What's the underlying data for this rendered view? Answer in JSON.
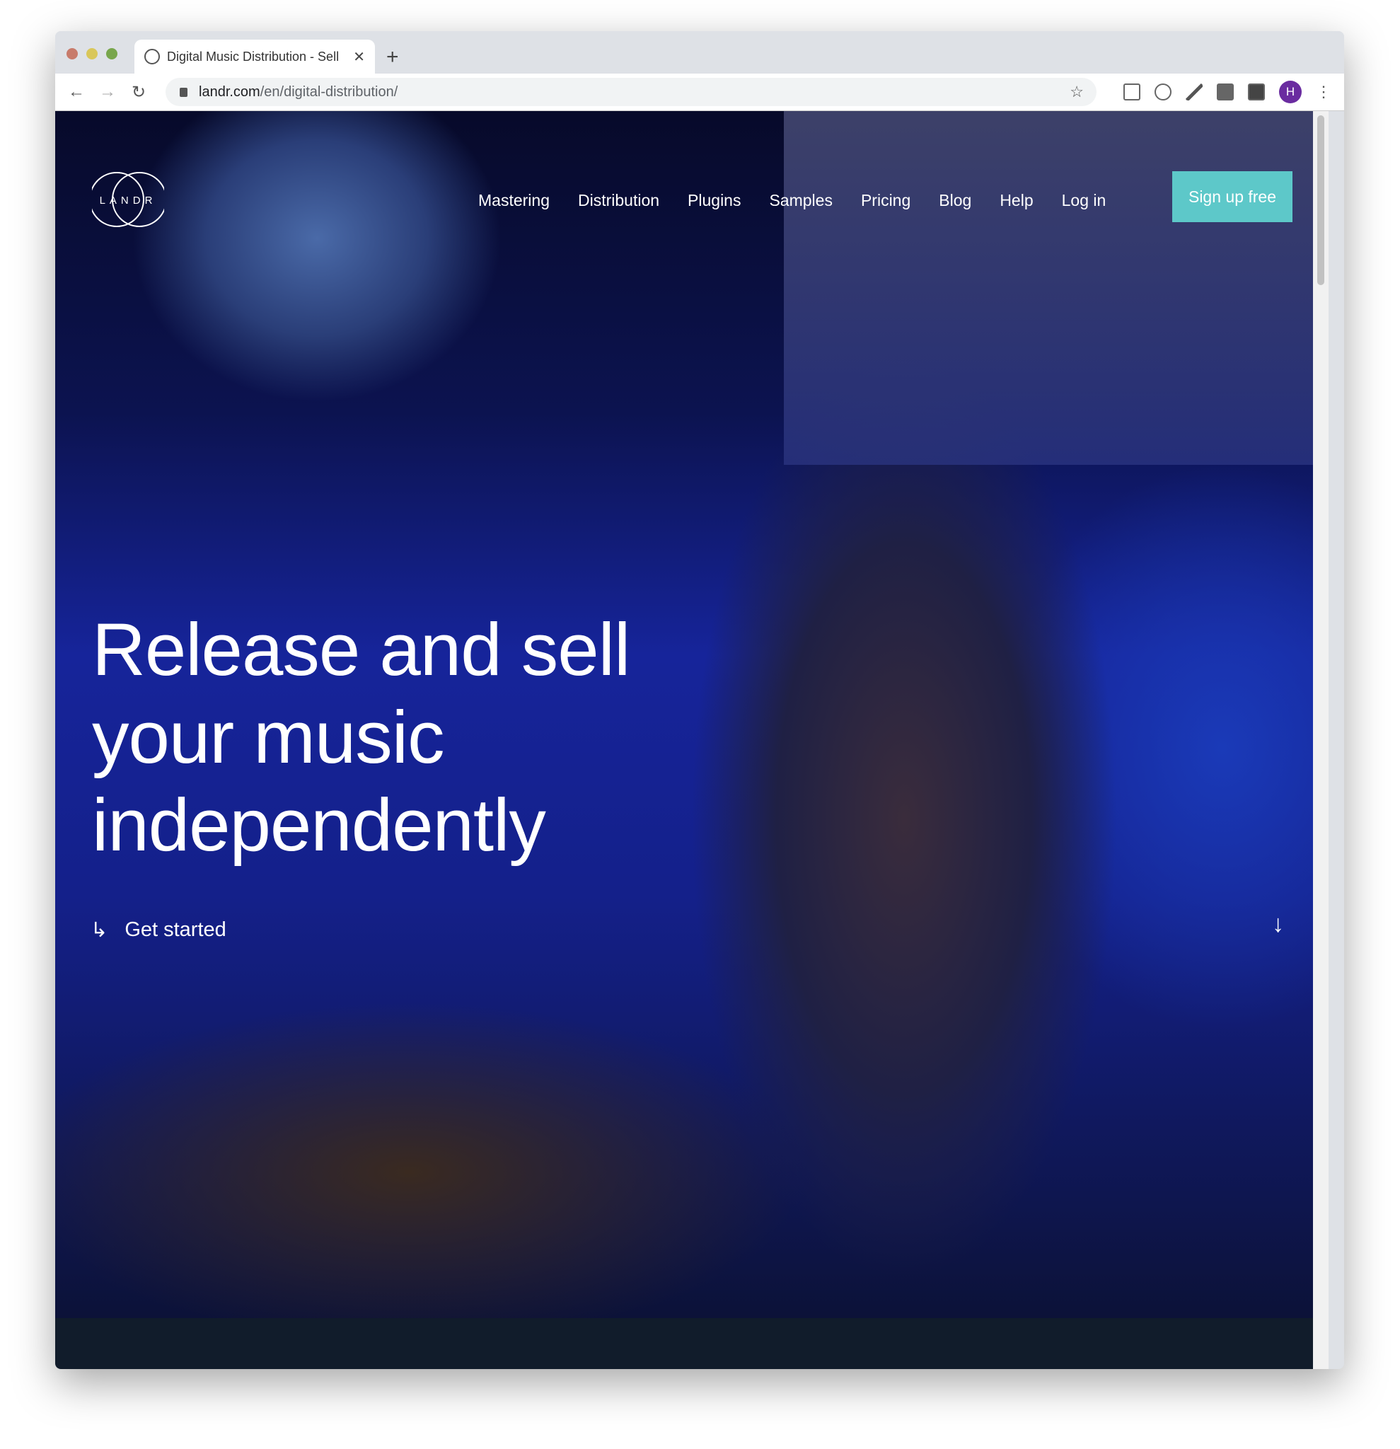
{
  "browser": {
    "tab_title": "Digital Music Distribution - Sell",
    "url_host": "landr.com",
    "url_path": "/en/digital-distribution/",
    "avatar_letter": "H"
  },
  "site": {
    "logo_text": "LANDR",
    "nav": [
      {
        "label": "Mastering"
      },
      {
        "label": "Distribution"
      },
      {
        "label": "Plugins"
      },
      {
        "label": "Samples"
      },
      {
        "label": "Pricing"
      },
      {
        "label": "Blog"
      },
      {
        "label": "Help"
      },
      {
        "label": "Log in"
      }
    ],
    "signup_label": "Sign up free",
    "headline": "Release and sell your music independently",
    "cta_label": "Get started",
    "accent": "#5dc8c9"
  }
}
